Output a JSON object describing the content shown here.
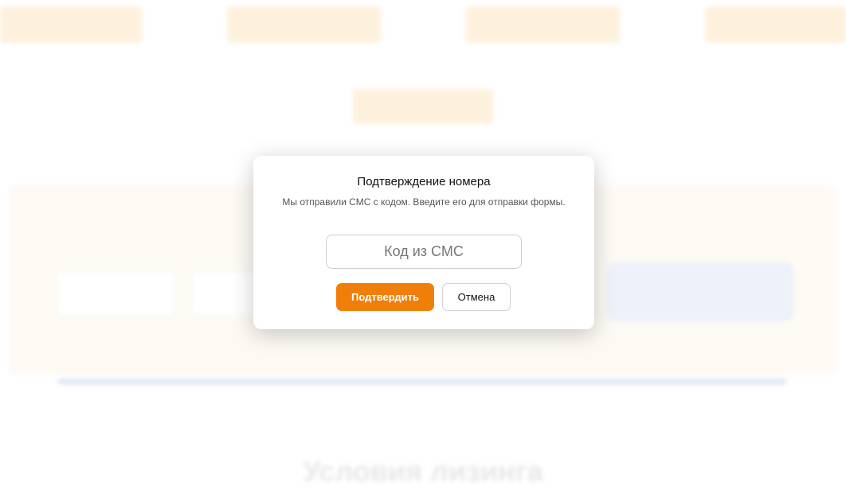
{
  "background": {
    "top_buttons": [
      "",
      "",
      "",
      ""
    ],
    "center_button": "",
    "panel_heading": "",
    "inputs": [
      {
        "placeholder": ""
      },
      {
        "placeholder": ""
      }
    ],
    "submit_button": "",
    "note": "",
    "section_title": "Условия лизинга"
  },
  "modal": {
    "title": "Подтверждение номера",
    "message": "Мы отправили СМС с кодом. Введите его для отправки формы.",
    "code_input": {
      "placeholder": "Код из СМС",
      "value": ""
    },
    "confirm_label": "Подтвердить",
    "cancel_label": "Отмена"
  },
  "colors": {
    "accent": "#f07f0a",
    "background_button": "#fde6c3",
    "background_panel": "#fdf6ec",
    "divider": "#c9d6ea"
  }
}
